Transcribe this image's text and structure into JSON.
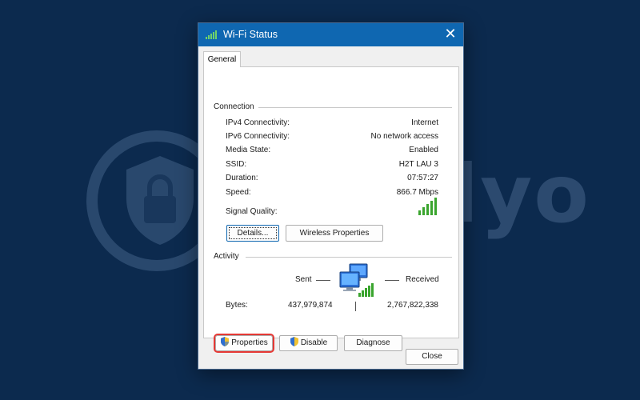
{
  "watermark": {
    "text": "Safelyo"
  },
  "window": {
    "title": "Wi-Fi Status",
    "close_glyph": "✕"
  },
  "tabs": [
    {
      "label": "General",
      "selected": true
    }
  ],
  "connection": {
    "heading": "Connection",
    "rows": [
      {
        "label": "IPv4 Connectivity:",
        "value": "Internet"
      },
      {
        "label": "IPv6 Connectivity:",
        "value": "No network access"
      },
      {
        "label": "Media State:",
        "value": "Enabled"
      },
      {
        "label": "SSID:",
        "value": "H2T LAU 3"
      },
      {
        "label": "Duration:",
        "value": "07:57:27"
      },
      {
        "label": "Speed:",
        "value": "866.7 Mbps"
      }
    ],
    "signal_label": "Signal Quality:",
    "signal_bars": 5,
    "details_button": "Details...",
    "wireless_button": "Wireless Properties"
  },
  "activity": {
    "heading": "Activity",
    "sent_label": "Sent",
    "received_label": "Received",
    "bytes_label": "Bytes:",
    "bytes_sent": "437,979,874",
    "bytes_received": "2,767,822,338",
    "icon": "network-computers-icon"
  },
  "footer": {
    "properties_button": "Properties",
    "disable_button": "Disable",
    "diagnose_button": "Diagnose",
    "close_button": "Close"
  },
  "colors": {
    "background": "#0c2a4e",
    "titlebar": "#0f67b1",
    "signal": "#3aa52e",
    "highlight": "#e53935"
  }
}
